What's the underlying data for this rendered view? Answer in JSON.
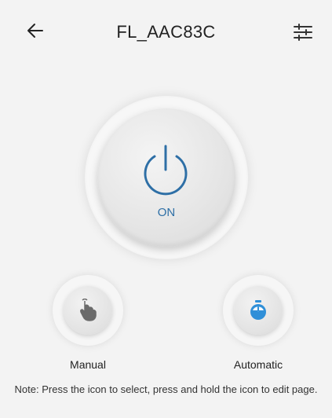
{
  "header": {
    "title": "FL_AAC83C",
    "back_icon": "arrow-left-icon",
    "settings_icon": "sliders-icon"
  },
  "power": {
    "label": "ON",
    "icon": "power-icon",
    "accent_color": "#2e6fa6"
  },
  "modes": {
    "manual": {
      "label": "Manual",
      "icon": "hand-pointer-icon"
    },
    "automatic": {
      "label": "Automatic",
      "icon": "stopwatch-icon",
      "icon_color": "#2f8fd8"
    }
  },
  "note": "Note: Press the icon to select, press and hold the icon to edit page."
}
